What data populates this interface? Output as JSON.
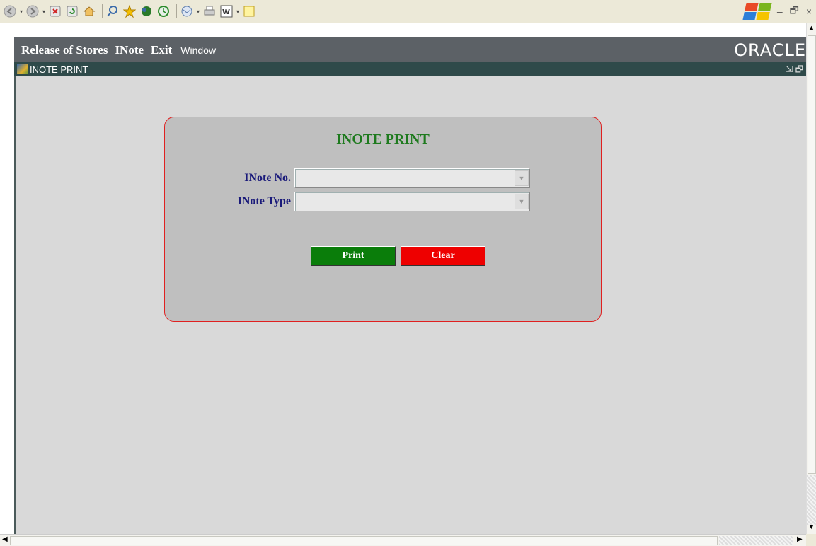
{
  "menubar": {
    "items": [
      {
        "label": "Release of Stores"
      },
      {
        "label": "INote"
      },
      {
        "label": "Exit"
      }
    ],
    "window_label": "Window",
    "brand": "ORACLE"
  },
  "window": {
    "title": "INOTE PRINT"
  },
  "form": {
    "heading": "INOTE PRINT",
    "inote_no_label": "INote No.",
    "inote_no_value": "",
    "inote_type_label": "INote Type",
    "inote_type_value": "",
    "print_label": "Print",
    "clear_label": "Clear"
  },
  "colors": {
    "menubar_bg": "#5c6166",
    "titlebar_bg": "#2f4a4a",
    "heading": "#1e7a1e",
    "label": "#1a1a7a",
    "print_button": "#0a7d0a",
    "clear_button": "#ee0000",
    "panel_border": "#e02020"
  },
  "toolbar_icons": [
    "back-icon",
    "forward-icon",
    "stop-icon",
    "refresh-icon",
    "home-icon",
    "search-icon",
    "favorites-icon",
    "media-icon",
    "history-icon",
    "mail-icon",
    "print-icon",
    "word-icon",
    "note-icon"
  ]
}
